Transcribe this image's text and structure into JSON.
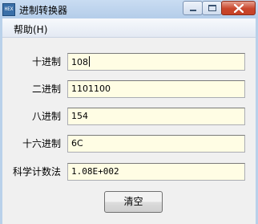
{
  "window": {
    "title": "进制转换器",
    "icon_label": "HEX"
  },
  "menu": {
    "help": "帮助(H)"
  },
  "fields": {
    "decimal": {
      "label": "十进制",
      "value": "108"
    },
    "binary": {
      "label": "二进制",
      "value": "1101100"
    },
    "octal": {
      "label": "八进制",
      "value": "154"
    },
    "hex": {
      "label": "十六进制",
      "value": "6C"
    },
    "scientific": {
      "label": "科学计数法",
      "value": "1.08E+002"
    }
  },
  "buttons": {
    "clear": "清空"
  },
  "colors": {
    "field_background": "#fffde4",
    "close_button": "#c9462c",
    "titlebar": "#b9d1ea"
  },
  "icons": [
    "app-icon",
    "minimize-icon",
    "maximize-icon",
    "close-icon"
  ]
}
